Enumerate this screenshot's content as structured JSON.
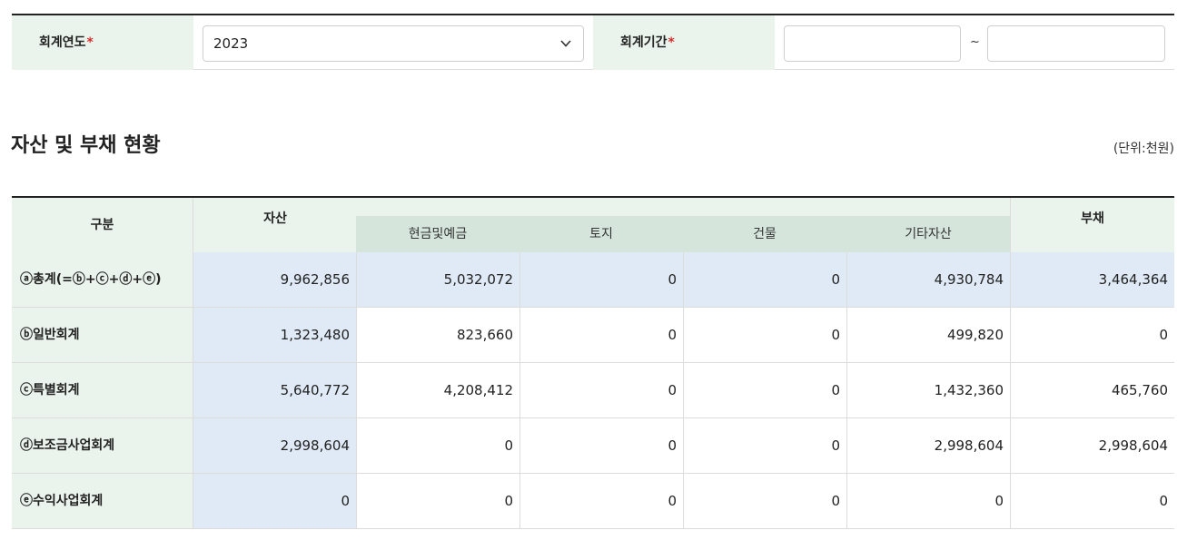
{
  "filter": {
    "year_label": "회계연도",
    "period_label": "회계기간",
    "required_mark": "*",
    "year_value": "2023",
    "period_start": "",
    "period_end": "",
    "separator": "~"
  },
  "section": {
    "title": "자산 및 부채 현황",
    "unit": "(단위:천원)"
  },
  "table": {
    "headers": {
      "category": "구분",
      "assets": "자산",
      "cash": "현금및예금",
      "land": "토지",
      "building": "건물",
      "other": "기타자산",
      "liabilities": "부채"
    },
    "rows": [
      {
        "label": "ⓐ총계(=ⓑ+ⓒ+ⓓ+ⓔ)",
        "assets": "9,962,856",
        "cash": "5,032,072",
        "land": "0",
        "building": "0",
        "other": "4,930,784",
        "liabilities": "3,464,364"
      },
      {
        "label": "ⓑ일반회계",
        "assets": "1,323,480",
        "cash": "823,660",
        "land": "0",
        "building": "0",
        "other": "499,820",
        "liabilities": "0"
      },
      {
        "label": "ⓒ특별회계",
        "assets": "5,640,772",
        "cash": "4,208,412",
        "land": "0",
        "building": "0",
        "other": "1,432,360",
        "liabilities": "465,760"
      },
      {
        "label": "ⓓ보조금사업회계",
        "assets": "2,998,604",
        "cash": "0",
        "land": "0",
        "building": "0",
        "other": "2,998,604",
        "liabilities": "2,998,604"
      },
      {
        "label": "ⓔ수익사업회계",
        "assets": "0",
        "cash": "0",
        "land": "0",
        "building": "0",
        "other": "0",
        "liabilities": "0"
      }
    ]
  },
  "colors": {
    "header_green": "#eaf3ec",
    "subheader_green": "#d5e5dc",
    "highlight_blue": "#dfeaf6",
    "required_red": "#d0312d"
  }
}
